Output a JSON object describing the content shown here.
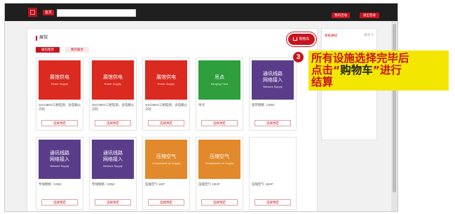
{
  "topbar": {
    "home_label": "首页",
    "search_value": "",
    "right_buttons": [
      "我的活动",
      "退出登录"
    ]
  },
  "main": {
    "title": "展馆",
    "tabs": [
      "展馆租赁",
      "我的服务"
    ],
    "cart_label": "购物车"
  },
  "sidebar": {
    "title": "系统通知",
    "close_label": "关闭 ✕"
  },
  "cards": [
    {
      "title": "展馆供电",
      "subtitle": "Power Supply",
      "desc": "15A/380V三相电源，含电箱火灾险",
      "color": "red",
      "button": "选择预定"
    },
    {
      "title": "展馆供电",
      "subtitle": "Power Supply",
      "desc": "30A/380V三相电源，含电箱火灾险",
      "color": "red",
      "button": "选择预定"
    },
    {
      "title": "展馆供电",
      "subtitle": "Power Supply",
      "desc": "40A/380V三相电源，含电箱火灾险",
      "color": "red",
      "button": "选择预定"
    },
    {
      "title": "吊点",
      "subtitle": "Hanging Point",
      "desc": "吊点",
      "color": "green",
      "button": "选择预定"
    },
    {
      "title": "通讯线路\n网络接入",
      "subtitle": "Network Supply",
      "desc": "宽带网络（20M）",
      "color": "purple",
      "button": "选择预定"
    },
    {
      "title": "通讯线路\n网络接入",
      "subtitle": "Network Supply",
      "desc": "专线网络（10M）",
      "color": "purple",
      "button": "选择预定"
    },
    {
      "title": "通讯线路\n网络接入",
      "subtitle": "Network Supply",
      "desc": "专线网络（20M）",
      "color": "purple",
      "button": "选择预定"
    },
    {
      "title": "压缩空气",
      "subtitle": "Compressed air Supply",
      "desc": "压缩空气 5HP",
      "color": "orange",
      "button": "选择预定"
    },
    {
      "title": "压缩空气",
      "subtitle": "Compressed air Supply",
      "desc": "压缩空气 10HP",
      "color": "orange",
      "button": "选择预定"
    },
    {
      "title": "",
      "subtitle": "",
      "desc": "压缩空气 15HP",
      "color": "blank",
      "button": "选择预定"
    }
  ],
  "callout": {
    "step": "3",
    "line1": "所有设施选择完毕后",
    "line2_a": "点击“",
    "line2_b": "购物车",
    "line2_c": "”进行",
    "line3": "结算"
  },
  "colors": {
    "accent": "#c8141d",
    "callout_bg": "#f3e600",
    "red_tile": "#db2a1f",
    "green_tile": "#2f9e3d",
    "purple_tile": "#5a3d8a",
    "orange_tile": "#e28a2b"
  }
}
